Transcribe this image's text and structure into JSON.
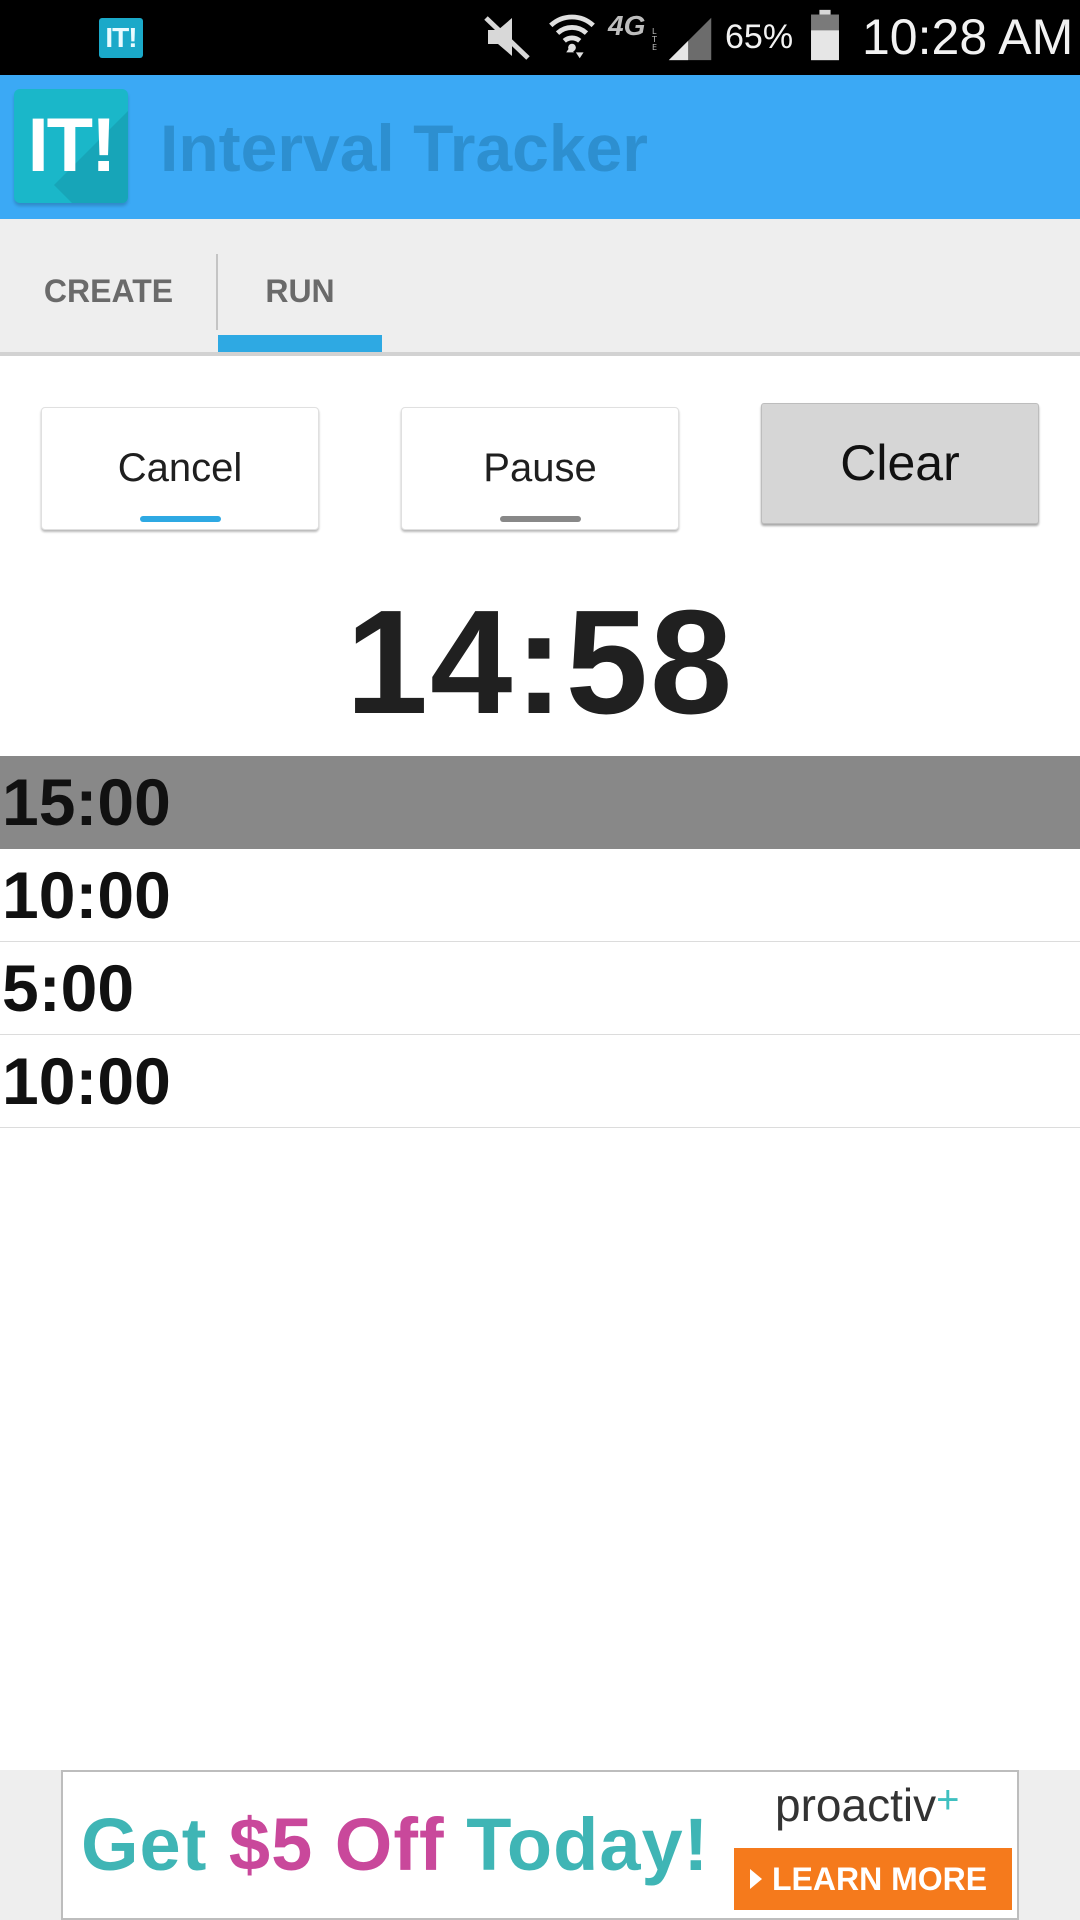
{
  "status_bar": {
    "app_icon_label": "IT!",
    "icons": [
      "app-notification-icon",
      "mute-icon",
      "wifi-icon",
      "lte-icon",
      "signal-icon",
      "battery-icon"
    ],
    "network_label": "4G",
    "battery_percent": "65%",
    "battery_level": 0.65,
    "time": "10:28 AM"
  },
  "action_bar": {
    "logo_text": "IT!",
    "title": "Interval Tracker",
    "background_color": "#3ba9f5",
    "title_color": "#2d8fd0"
  },
  "tabs": [
    {
      "label": "CREATE",
      "selected": false
    },
    {
      "label": "RUN",
      "selected": true
    }
  ],
  "controls": {
    "cancel_label": "Cancel",
    "pause_label": "Pause",
    "clear_label": "Clear"
  },
  "timer": {
    "value": "14:58"
  },
  "intervals": [
    {
      "label": "15:00",
      "active": true
    },
    {
      "label": "10:00",
      "active": false
    },
    {
      "label": "5:00",
      "active": false
    },
    {
      "label": "10:00",
      "active": false
    }
  ],
  "ad": {
    "headline_get": "Get ",
    "headline_offer": "$5 Off",
    "headline_today": " Today!",
    "brand": "proactiv",
    "brand_plus": "+",
    "cta_label": "LEARN MORE"
  },
  "colors": {
    "accent": "#2ea9e3",
    "active_row": "#888888",
    "ad_teal": "#3fb5b5",
    "ad_magenta": "#c9489b",
    "ad_orange": "#f57a1c"
  }
}
